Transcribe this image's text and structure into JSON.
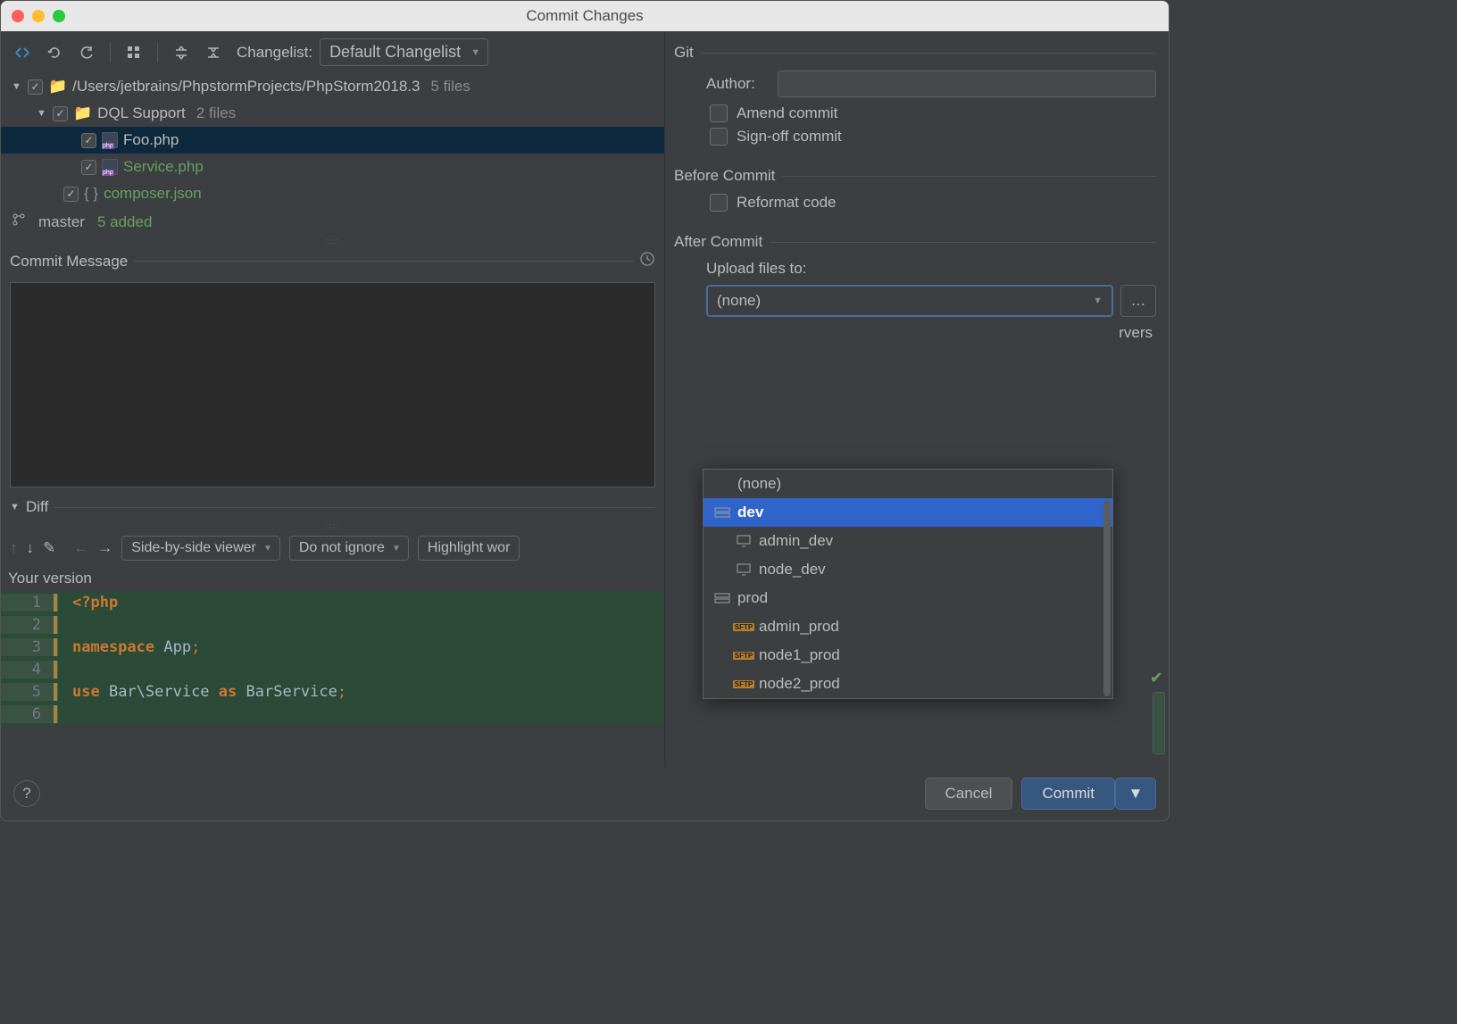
{
  "window": {
    "title": "Commit Changes"
  },
  "toolbar": {
    "changelist_label": "Changelist:",
    "changelist_value": "Default Changelist"
  },
  "tree": {
    "root": {
      "path": "/Users/jetbrains/PhpstormProjects/PhpStorm2018.3",
      "count": "5 files"
    },
    "folder1": {
      "name": "DQL Support",
      "count": "2 files"
    },
    "files": [
      {
        "name": "Foo.php"
      },
      {
        "name": "Service.php"
      },
      {
        "name": "composer.json"
      }
    ]
  },
  "branch": {
    "name": "master",
    "status": "5 added"
  },
  "commit_message_label": "Commit Message",
  "diff": {
    "label": "Diff",
    "viewer": "Side-by-side viewer",
    "ignore": "Do not ignore",
    "highlight": "Highlight wor",
    "your_version": "Your version"
  },
  "code": {
    "l1": "<?php",
    "l3a": "namespace",
    "l3b": " App",
    "l3c": ";",
    "l5a": "use",
    "l5b": " Bar\\Service ",
    "l5c": "as",
    "l5d": " BarService",
    "l5e": ";"
  },
  "git": {
    "section": "Git",
    "author_label": "Author:",
    "amend": "Amend commit",
    "signoff": "Sign-off commit"
  },
  "before": {
    "section": "Before Commit",
    "reformat": "Reformat code"
  },
  "after": {
    "section": "After Commit",
    "upload_label": "Upload files to:",
    "selected": "(none)",
    "servers_text": "rvers",
    "options": [
      {
        "label": "(none)",
        "indent": 0,
        "icon": ""
      },
      {
        "label": "dev",
        "indent": 0,
        "icon": "group",
        "hl": true
      },
      {
        "label": "admin_dev",
        "indent": 1,
        "icon": "server"
      },
      {
        "label": "node_dev",
        "indent": 1,
        "icon": "server"
      },
      {
        "label": "prod",
        "indent": 0,
        "icon": "group"
      },
      {
        "label": "admin_prod",
        "indent": 1,
        "icon": "sftp"
      },
      {
        "label": "node1_prod",
        "indent": 1,
        "icon": "sftp"
      },
      {
        "label": "node2_prod",
        "indent": 1,
        "icon": "sftp"
      }
    ]
  },
  "buttons": {
    "cancel": "Cancel",
    "commit": "Commit",
    "help": "?"
  }
}
